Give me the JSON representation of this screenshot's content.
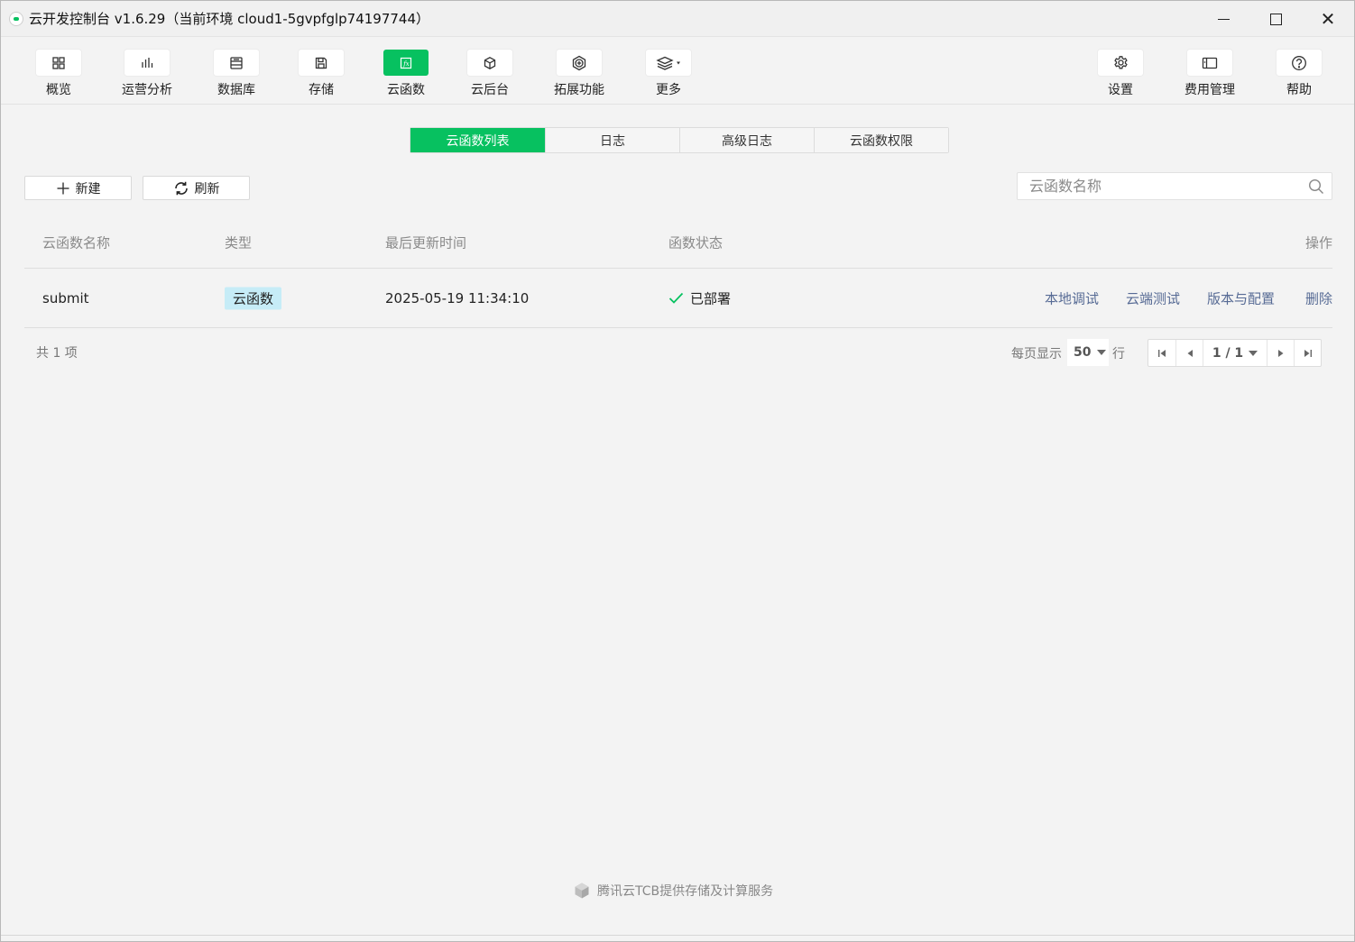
{
  "window": {
    "title": "云开发控制台 v1.6.29（当前环境 cloud1-5gvpfglp74197744）"
  },
  "toolbar": {
    "left": [
      {
        "label": "概览",
        "icon": "grid-icon"
      },
      {
        "label": "运营分析",
        "icon": "bar-chart-icon"
      },
      {
        "label": "数据库",
        "icon": "database-icon"
      },
      {
        "label": "存储",
        "icon": "save-icon"
      },
      {
        "label": "云函数",
        "icon": "function-icon",
        "active": true
      },
      {
        "label": "云后台",
        "icon": "cube-icon"
      },
      {
        "label": "拓展功能",
        "icon": "plus-hexagon-icon"
      },
      {
        "label": "更多",
        "icon": "layers-icon"
      }
    ],
    "right": [
      {
        "label": "设置",
        "icon": "gear-icon"
      },
      {
        "label": "费用管理",
        "icon": "billing-icon"
      },
      {
        "label": "帮助",
        "icon": "help-icon"
      }
    ]
  },
  "tabs": [
    {
      "label": "云函数列表",
      "active": true
    },
    {
      "label": "日志"
    },
    {
      "label": "高级日志"
    },
    {
      "label": "云函数权限"
    }
  ],
  "actions": {
    "new_label": "新建",
    "refresh_label": "刷新"
  },
  "search": {
    "placeholder": "云函数名称",
    "value": ""
  },
  "table": {
    "columns": [
      "云函数名称",
      "类型",
      "最后更新时间",
      "函数状态",
      "操作"
    ],
    "rows": [
      {
        "name": "submit",
        "type": "云函数",
        "updated": "2025-05-19 11:34:10",
        "status": "已部署",
        "ops": [
          "本地调试",
          "云端测试",
          "版本与配置",
          "删除"
        ]
      }
    ]
  },
  "pagination": {
    "total": "共 1 项",
    "per_page_label": "每页显示",
    "per_page": "50",
    "rows_label": "行",
    "current": "1 / 1"
  },
  "footer": {
    "credit": "腾讯云TCB提供存储及计算服务"
  },
  "colors": {
    "accent": "#07c160",
    "link": "#576b95",
    "badge": "#c6ecf7"
  }
}
